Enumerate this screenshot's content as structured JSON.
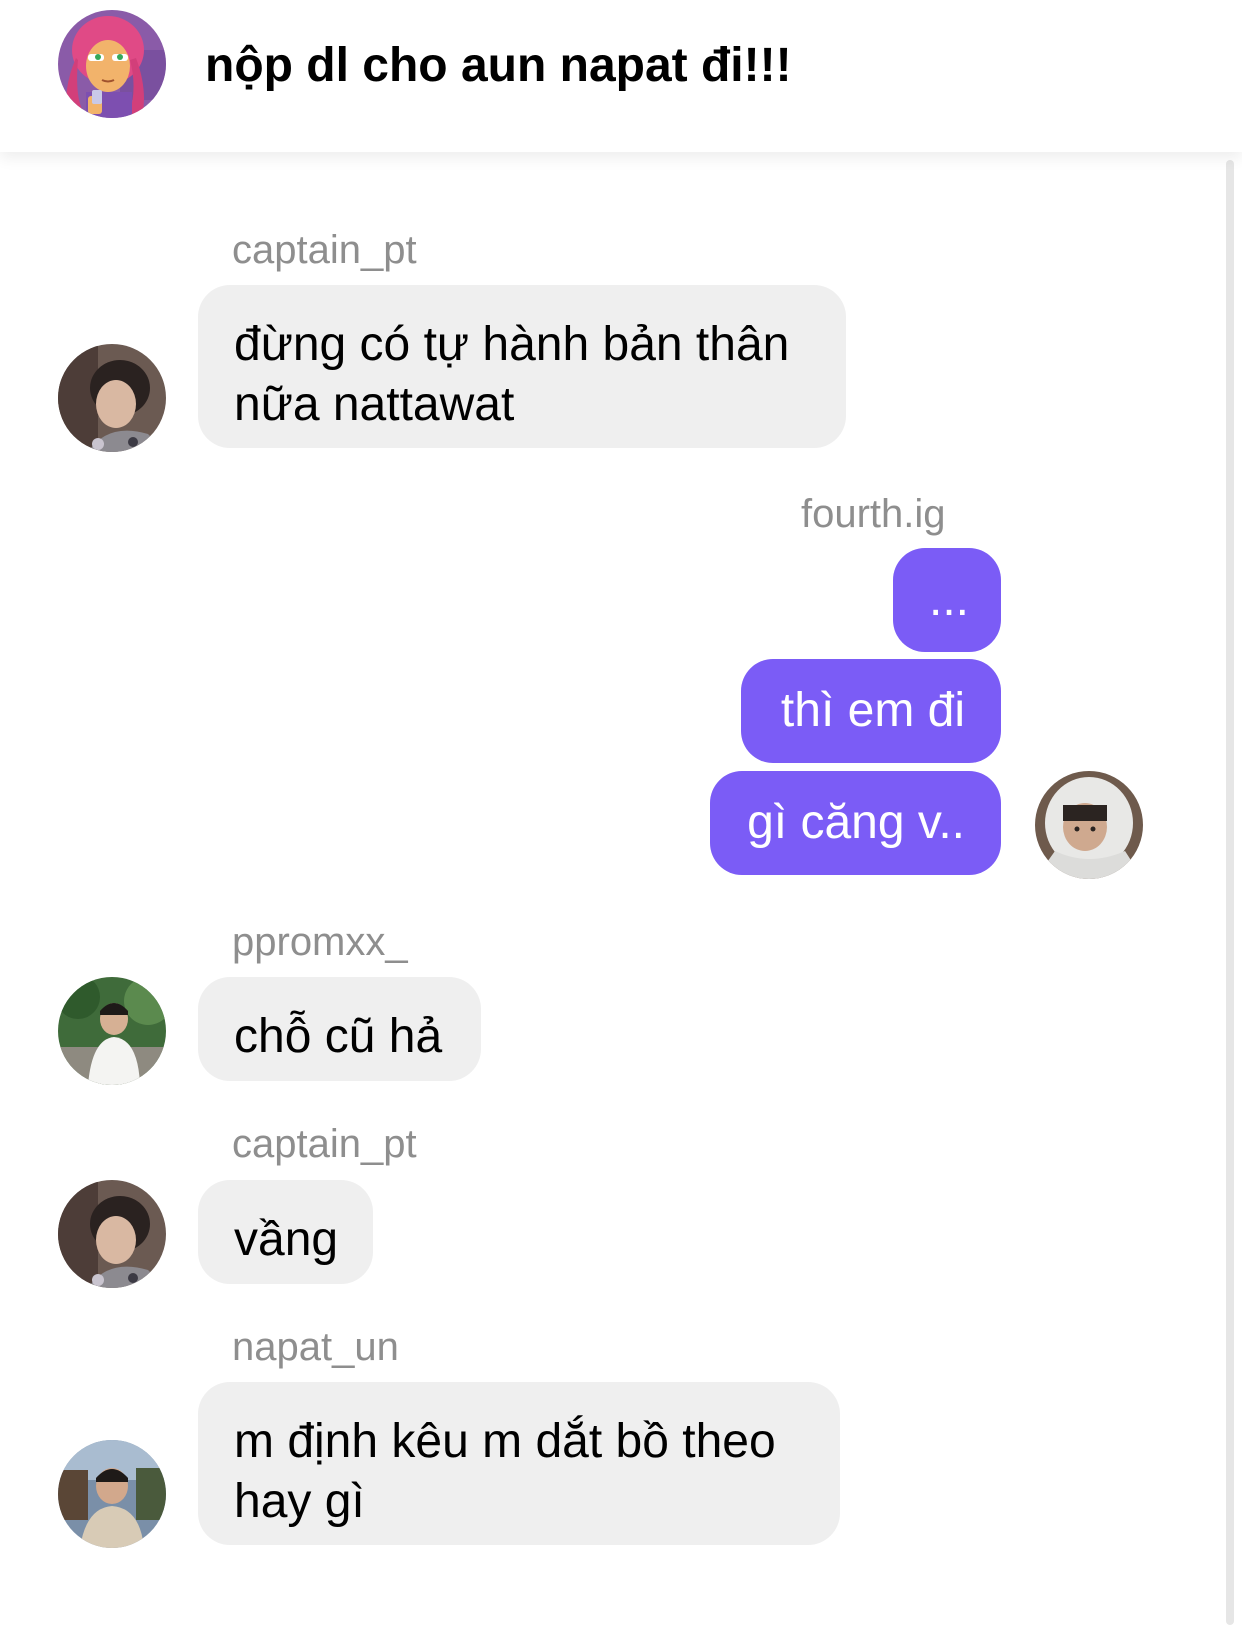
{
  "header": {
    "title": "nộp dl cho aun napat đi!!!",
    "avatar_icon": "cartoon-girl-avatar"
  },
  "colors": {
    "outgoing_bubble": "#7b5cf6",
    "incoming_bubble": "#efefef",
    "username_text": "#8e8e8e"
  },
  "messages": [
    {
      "username": "captain_pt",
      "text": "đừng có tự hành bản thân\nnữa nattawat",
      "direction": "incoming"
    },
    {
      "username": "fourth.ig",
      "direction": "outgoing",
      "bubbles": [
        "...",
        "thì em đi",
        "gì căng v.."
      ]
    },
    {
      "username": "ppromxx_",
      "text": "chỗ cũ hả",
      "direction": "incoming"
    },
    {
      "username": "captain_pt",
      "text": "vầng",
      "direction": "incoming"
    },
    {
      "username": "napat_un",
      "text": "m định kêu m dắt bồ theo\nhay gì",
      "direction": "incoming"
    }
  ]
}
